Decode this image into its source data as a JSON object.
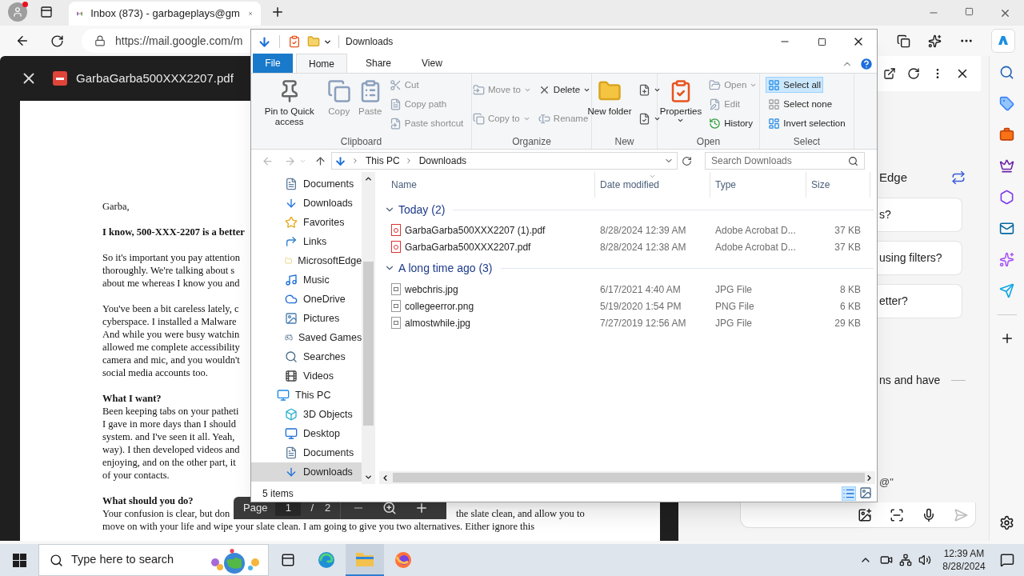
{
  "browser": {
    "tabs": [
      {
        "title": "Inbox (873) - garbageplays@gm",
        "selected": true
      }
    ],
    "url": "https://mail.google.com/m"
  },
  "pdf_viewer": {
    "filename": "GarbaGarba500XXX2207.pdf",
    "paragraphs": [
      {
        "lines": [
          {
            "text": "Garba,",
            "bold": false
          }
        ]
      },
      {
        "lines": [
          {
            "text": "I know, 500-XXX-2207 is a better",
            "bold": true
          }
        ]
      },
      {
        "lines": [
          {
            "text": "So it's important you pay attention",
            "bold": false
          },
          {
            "text": "thoroughly. We're talking about s",
            "bold": false
          },
          {
            "text": "about me whereas I know you and",
            "bold": false
          }
        ]
      },
      {
        "lines": [
          {
            "text": "You've been a bit careless lately, c",
            "bold": false
          },
          {
            "text": "cyberspace. I installed a Malware",
            "bold": false
          },
          {
            "text": "And while you were busy watchin",
            "bold": false
          },
          {
            "text": "allowed me complete accessibility",
            "bold": false
          },
          {
            "text": "camera and mic, and you wouldn't",
            "bold": false
          },
          {
            "text": "social media accounts too.",
            "bold": false
          }
        ]
      },
      {
        "lines": [
          {
            "text": "What I want?",
            "bold": true
          },
          {
            "text": "Been keeping tabs on your patheti",
            "bold": false
          },
          {
            "text": "I gave in more days than I should",
            "bold": false
          },
          {
            "text": "system. and I've seen it all. Yeah,",
            "bold": false
          },
          {
            "text": "way). I then developed videos and",
            "bold": false
          },
          {
            "text": "enjoying, and on the other part, it",
            "bold": false
          },
          {
            "text": "of your contacts.",
            "bold": false
          }
        ]
      },
      {
        "lines": [
          {
            "text": "What should you do?",
            "bold": true
          },
          {
            "text": "Your confusion is clear, but don",
            "bold": false,
            "after_toolbar": "the slate clean, and allow you to"
          },
          {
            "text": "move on with your life and wipe your slate clean. I am going to give you two alternatives. Either ignore this",
            "bold": false
          }
        ]
      }
    ],
    "page_toolbar": {
      "label": "Page",
      "page": "1",
      "separator": "/",
      "total": "2"
    }
  },
  "copilot": {
    "heading": "Edge",
    "suggestions": [
      "s?",
      "using filters?",
      "etter?"
    ],
    "message": "ns and have",
    "input_text": "@\""
  },
  "explorer": {
    "title": "Downloads",
    "ribbon": {
      "file_tab": "File",
      "tabs": [
        {
          "label": "Home",
          "selected": true
        },
        {
          "label": "Share",
          "selected": false
        },
        {
          "label": "View",
          "selected": false
        }
      ],
      "groups": [
        {
          "name": "Clipboard",
          "columns": [
            [
              {
                "label": "Pin to Quick access",
                "disabled": false
              }
            ],
            [
              {
                "label": "Copy",
                "disabled": true
              }
            ],
            [
              {
                "label": "Paste",
                "disabled": true
              }
            ],
            [
              {
                "label": "Cut",
                "disabled": true
              },
              {
                "label": "Copy path",
                "disabled": true
              },
              {
                "label": "Paste shortcut",
                "disabled": true
              }
            ]
          ]
        },
        {
          "name": "Organize",
          "columns": [
            [
              {
                "label": "Move to",
                "disabled": true,
                "dropdown": true
              },
              {
                "label": "Copy to",
                "disabled": true,
                "dropdown": true
              }
            ],
            [
              {
                "label": "Delete",
                "disabled": false,
                "dropdown": true
              },
              {
                "label": "Rename",
                "disabled": true
              }
            ]
          ]
        },
        {
          "name": "New",
          "columns": [
            [
              {
                "label": "New folder",
                "disabled": false
              }
            ],
            [
              {
                "disabled": false,
                "dropdown": true
              },
              {
                "disabled": false,
                "dropdown": true
              }
            ]
          ]
        },
        {
          "name": "Open",
          "columns": [
            [
              {
                "label": "Properties",
                "disabled": false,
                "dropdown": true
              }
            ],
            [
              {
                "label": "Open",
                "disabled": true,
                "dropdown": true
              },
              {
                "label": "Edit",
                "disabled": true
              },
              {
                "label": "History",
                "disabled": false
              }
            ]
          ]
        },
        {
          "name": "Select",
          "columns": [
            [
              {
                "label": "Select all",
                "disabled": false,
                "highlighted": true
              },
              {
                "label": "Select none",
                "disabled": false,
                "highlighted": false
              },
              {
                "label": "Invert selection",
                "disabled": false,
                "highlighted": false
              }
            ]
          ]
        }
      ]
    },
    "breadcrumb": [
      "This PC",
      "Downloads"
    ],
    "search": {
      "placeholder": "Search Downloads"
    },
    "tree": [
      {
        "children": [
          {
            "label": "Documents",
            "selected": false
          },
          {
            "label": "Downloads",
            "selected": false
          },
          {
            "label": "Favorites",
            "selected": false
          },
          {
            "label": "Links",
            "selected": false
          },
          {
            "label": "MicrosoftEdge",
            "selected": false
          },
          {
            "label": "Music",
            "selected": false
          },
          {
            "label": "OneDrive",
            "selected": false
          },
          {
            "label": "Pictures",
            "selected": false
          },
          {
            "label": "Saved Games",
            "selected": false
          },
          {
            "label": "Searches",
            "selected": false
          },
          {
            "label": "Videos",
            "selected": false
          }
        ]
      },
      {
        "label": "This PC",
        "selected": false,
        "children": [
          {
            "label": "3D Objects",
            "selected": false
          },
          {
            "label": "Desktop",
            "selected": false
          },
          {
            "label": "Documents",
            "selected": false
          },
          {
            "label": "Downloads",
            "selected": true
          }
        ]
      }
    ],
    "columns": [
      "Name",
      "Date modified",
      "Type",
      "Size"
    ],
    "groups": [
      {
        "label": "Today (2)",
        "expanded": true,
        "files": [
          {
            "name": "GarbaGarba500XXX2207 (1).pdf",
            "date": "8/28/2024 12:39 AM",
            "type": "Adobe Acrobat D...",
            "size": "37 KB",
            "kind": "pdf",
            "selected": false
          },
          {
            "name": "GarbaGarba500XXX2207.pdf",
            "date": "8/28/2024 12:38 AM",
            "type": "Adobe Acrobat D...",
            "size": "37 KB",
            "kind": "pdf",
            "selected": false
          }
        ]
      },
      {
        "label": "A long time ago (3)",
        "expanded": true,
        "files": [
          {
            "name": "webchris.jpg",
            "date": "6/17/2021 4:40 AM",
            "type": "JPG File",
            "size": "8 KB",
            "kind": "image",
            "selected": false
          },
          {
            "name": "collegeerror.png",
            "date": "5/19/2020 1:54 PM",
            "type": "PNG File",
            "size": "6 KB",
            "kind": "image",
            "selected": false
          },
          {
            "name": "almostwhile.jpg",
            "date": "7/27/2019 12:56 AM",
            "type": "JPG File",
            "size": "29 KB",
            "kind": "image",
            "selected": false
          }
        ]
      }
    ],
    "status": "5 items"
  },
  "taskbar": {
    "search": {
      "placeholder": "Type here to search"
    },
    "apps": [
      {
        "kind": "edge",
        "selected": false
      },
      {
        "kind": "explorer",
        "selected": true
      },
      {
        "kind": "firefox",
        "selected": false
      }
    ],
    "time": "12:39 AM",
    "date": "8/28/2024"
  }
}
